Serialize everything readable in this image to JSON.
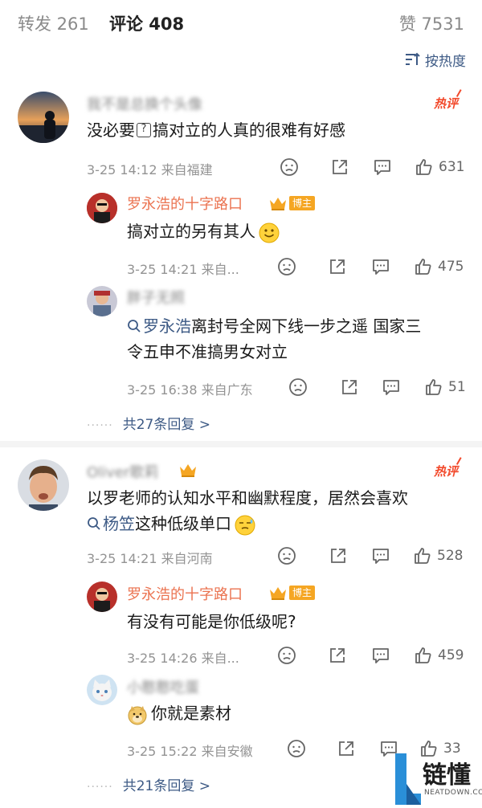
{
  "tabs": {
    "repost": "转发 261",
    "comments": "评论 408",
    "likes": "赞 7531"
  },
  "sort_label": "按热度",
  "hot_label": "热评",
  "owner_badge": "博主",
  "thread1": {
    "user": "我不是总换个头像",
    "text_a": "没必要",
    "text_b": "搞对立的人真的很难有好感",
    "meta": "3-25 14:12 来自福建",
    "likes": "631",
    "reply1": {
      "user": "罗永浩的十字路口",
      "text": "搞对立的另有其人",
      "meta": "3-25 14:21 来自...",
      "likes": "475"
    },
    "reply2": {
      "user": "胖子无照",
      "link": "罗永浩",
      "text_line1": "离封号全网下线一步之遥 国家三",
      "text_line2": "令五申不准搞男女对立",
      "meta": "3-25 16:38 来自广东",
      "likes": "51"
    },
    "more": "共27条回复 >"
  },
  "thread2": {
    "user": "Oliver歌莉",
    "text_line1": "以罗老师的认知水平和幽默程度，居然会喜欢",
    "link": "杨笠",
    "text_line2": "这种低级单口",
    "meta": "3-25 14:21 来自河南",
    "likes": "528",
    "reply1": {
      "user": "罗永浩的十字路口",
      "text": "有没有可能是你低级呢?",
      "meta": "3-25 14:26 来自...",
      "likes": "459"
    },
    "reply2": {
      "user": "小憨憨吃蛋",
      "text": "你就是素材",
      "meta": "3-25 15:22 来自安徽",
      "likes": "33"
    },
    "more": "共21条回复 >"
  },
  "watermark": {
    "brand": "链懂",
    "site": "NEATDOWN.COM"
  },
  "colors": {
    "accent_blue": "#3d5a85",
    "owner_orange": "#eb7350",
    "hot_red": "#f2492b",
    "badge_gold": "#f5a623"
  }
}
